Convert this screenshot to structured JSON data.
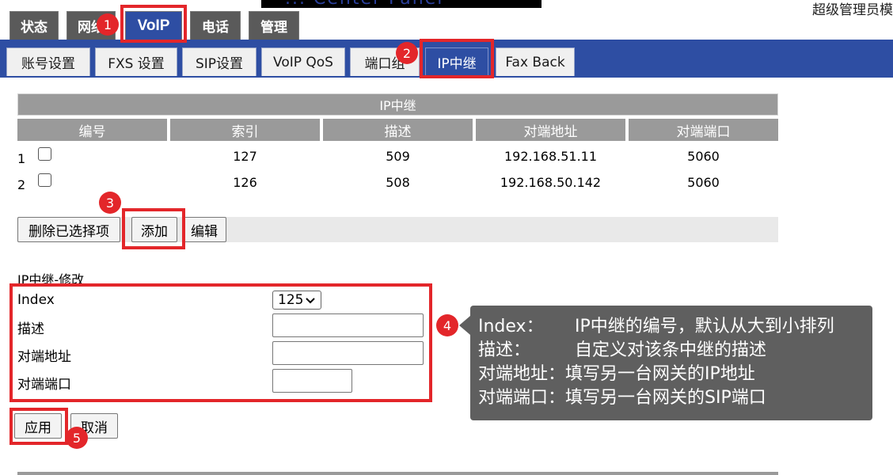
{
  "header": {
    "brand_text": "... Center Panel",
    "user_label": "超级管理员模",
    "main_tabs": [
      "状态",
      "网络",
      "VoIP",
      "电话",
      "管理"
    ],
    "active_main_tab": "VoIP"
  },
  "sub_tabs": [
    "账号设置",
    "FXS 设置",
    "SIP设置",
    "VoIP QoS",
    "端口组",
    "IP中继",
    "Fax Back"
  ],
  "active_sub_tab": "IP中继",
  "table": {
    "caption": "IP中继",
    "columns": [
      "编号",
      "索引",
      "描述",
      "对端地址",
      "对端端口"
    ],
    "rows": [
      {
        "no": "1",
        "index": "127",
        "desc": "509",
        "addr": "192.168.51.11",
        "port": "5060",
        "checked": false
      },
      {
        "no": "2",
        "index": "126",
        "desc": "508",
        "addr": "192.168.50.142",
        "port": "5060",
        "checked": false
      }
    ]
  },
  "actions": {
    "delete_label": "删除已选择项",
    "add_label": "添加",
    "edit_label": "编辑"
  },
  "form": {
    "title": "IP中继-修改",
    "index_label": "Index",
    "index_value": "125",
    "desc_label": "描述",
    "desc_value": "",
    "addr_label": "对端地址",
    "addr_value": "",
    "port_label": "对端端口",
    "port_value": "",
    "apply_label": "应用",
    "cancel_label": "取消"
  },
  "annotations": {
    "badges": [
      "1",
      "2",
      "3",
      "4",
      "5"
    ],
    "highlight_color": "#e3262a",
    "callout": [
      {
        "key": "Index：",
        "text": "IP中继的编号，默认从大到小排列"
      },
      {
        "key": "描述：",
        "text": "自定义对该条中继的描述"
      },
      {
        "key": "对端地址：",
        "text": "填写另一台网关的IP地址"
      },
      {
        "key": "对端端口：",
        "text": "填写另一台网关的SIP端口"
      }
    ]
  },
  "colors": {
    "nav_blue": "#2e4ea3",
    "header_gray": "#9a9a9a",
    "tab_dark": "#5a5a5a",
    "callout_bg": "#5f5f5f"
  }
}
